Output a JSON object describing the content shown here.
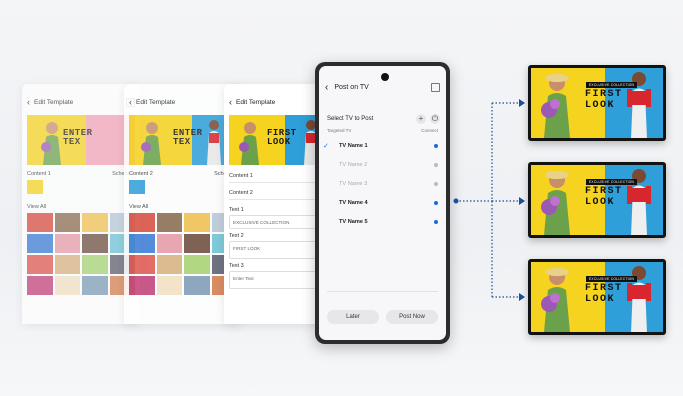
{
  "left_screens": {
    "s1": {
      "title": "Edit Template",
      "preview_text": "ENTER\nTEX",
      "content_label": "Content 1",
      "content_right": "Schedule",
      "view_all": "View All"
    },
    "s2": {
      "title": "Edit Template",
      "preview_text": "ENTER\nTEX",
      "content_label": "Content 2",
      "content_right": "Schedule",
      "view_all": "View All"
    },
    "s3": {
      "title": "Edit Template",
      "preview_text": "FIRST\nLOOK",
      "content1": "Content 1",
      "content2": "Content 2",
      "text1_label": "Text 1",
      "text1_value": "EXCLUSIVE COLLECTION",
      "text2_label": "Text 2",
      "text2_value": "FIRST LOOK",
      "text3_label": "Text 3",
      "text3_value": "Enter Text"
    }
  },
  "phone": {
    "title": "Post on TV",
    "select_label": "Select TV to Post",
    "targeted_label": "Targeted TV",
    "connect_label": "Connect",
    "tv_list": [
      {
        "name": "TV Name 1",
        "state": "on",
        "checked": true
      },
      {
        "name": "TV Name 2",
        "state": "off",
        "checked": false
      },
      {
        "name": "TV Name 3",
        "state": "off",
        "checked": false
      },
      {
        "name": "TV Name 4",
        "state": "on",
        "checked": false
      },
      {
        "name": "TV Name 5",
        "state": "on",
        "checked": false
      }
    ],
    "later_label": "Later",
    "post_label": "Post Now"
  },
  "tv": {
    "tag": "EXCLUSIVE COLLECTION",
    "headline_line1": "FIRST",
    "headline_line2": "LOOK"
  },
  "colors": {
    "yellow": "#f6d31e",
    "cyan": "#2e9fd8",
    "accent": "#1a6fd6",
    "pink": "#f4a3b6"
  },
  "icons": [
    "back-arrow-icon",
    "expand-icon",
    "plus-icon",
    "power-icon",
    "check-icon",
    "arrow-right-icon"
  ]
}
